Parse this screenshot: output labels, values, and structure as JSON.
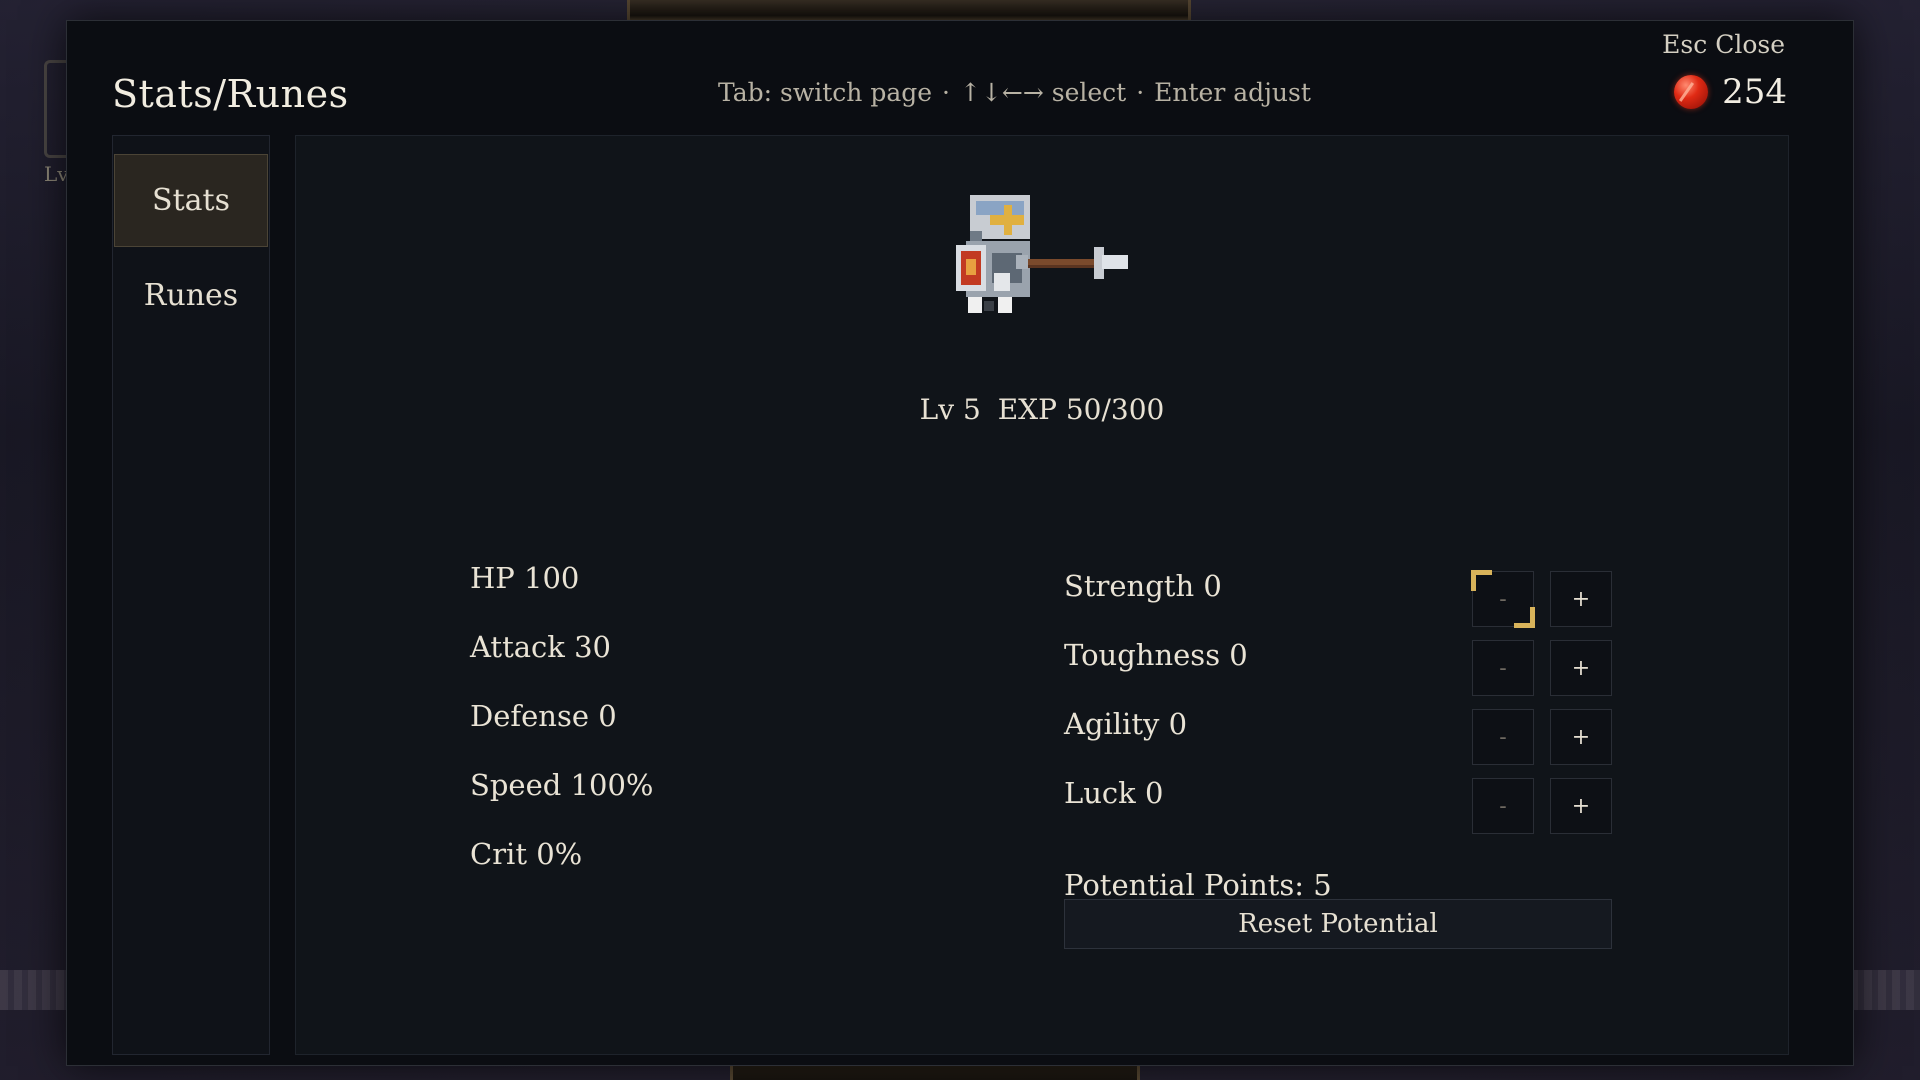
{
  "header": {
    "title": "Stats/Runes",
    "hint": {
      "tab": "Tab: switch page",
      "select": "↑↓←→ select",
      "enter": "Enter adjust",
      "separator": "·"
    },
    "close_label": "Esc Close",
    "currency": {
      "icon": "red-gem-icon",
      "value": "254"
    }
  },
  "background": {
    "hud_level_label": "Lv"
  },
  "sidebar": {
    "tabs": [
      {
        "label": "Stats",
        "active": true
      },
      {
        "label": "Runes",
        "active": false
      }
    ]
  },
  "character": {
    "sprite": "knight-with-spear-sprite",
    "level": "Lv 5",
    "exp": "EXP 50/300"
  },
  "stats": [
    "HP 100",
    "Attack 30",
    "Defense 0",
    "Speed 100%",
    "Crit 0%"
  ],
  "attributes": [
    {
      "label": "Strength 0",
      "minus": "-",
      "plus": "+",
      "focused": true
    },
    {
      "label": "Toughness 0",
      "minus": "-",
      "plus": "+",
      "focused": false
    },
    {
      "label": "Agility 0",
      "minus": "-",
      "plus": "+",
      "focused": false
    },
    {
      "label": "Luck 0",
      "minus": "-",
      "plus": "+",
      "focused": false
    }
  ],
  "potential_points": "Potential Points: 5",
  "reset_button": "Reset Potential",
  "colors": {
    "panel_bg": "#0b0d12",
    "content_bg": "#101419",
    "accent_gold": "#d8b35a",
    "active_tab_bg": "#2a2620",
    "gem_red": "#e02a14"
  }
}
